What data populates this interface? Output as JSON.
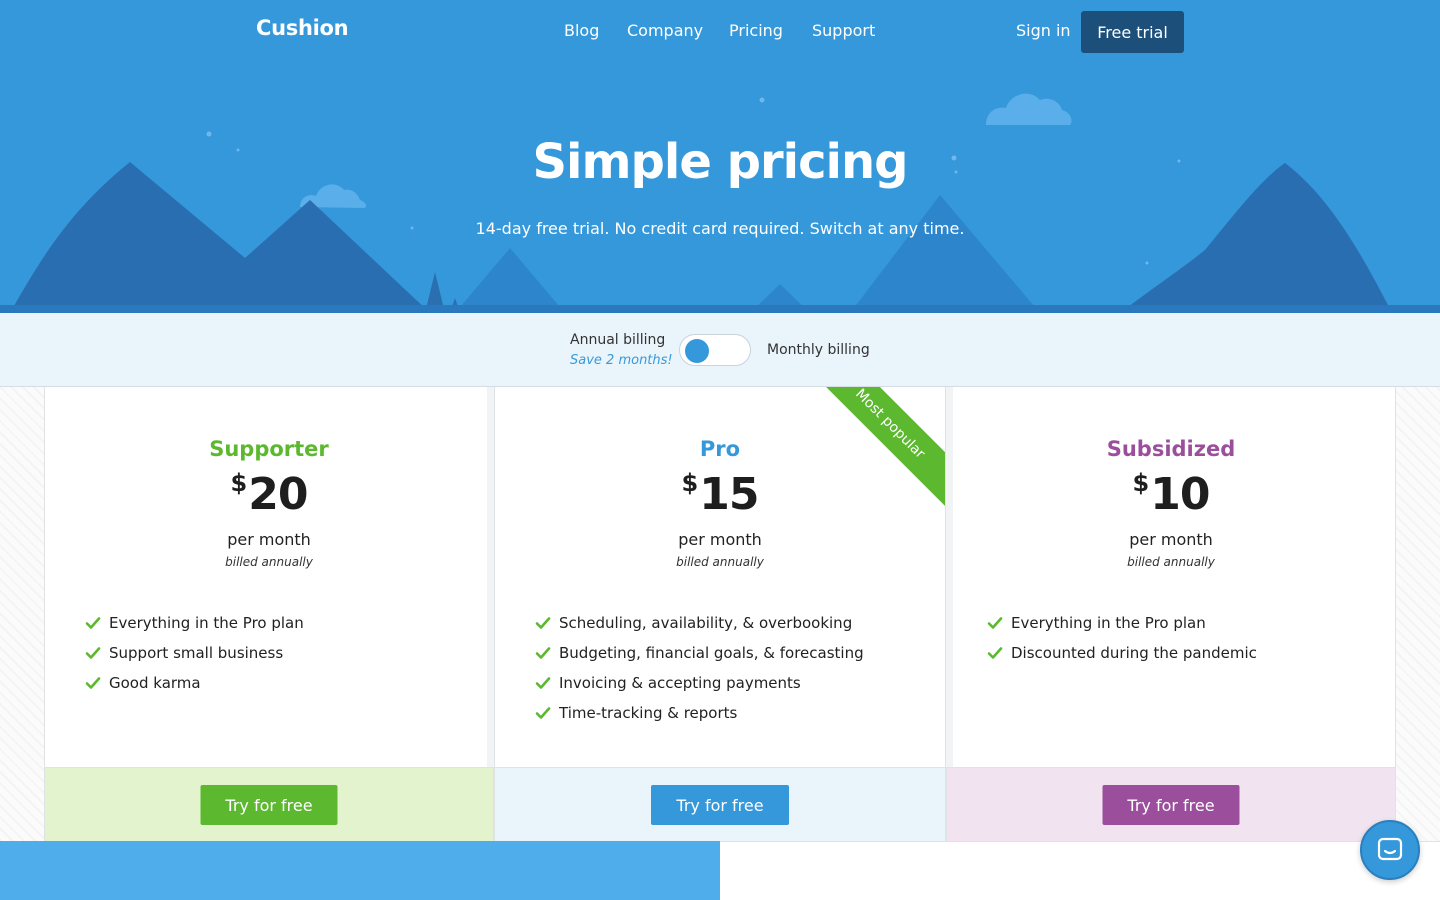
{
  "header": {
    "logo": "Cushion",
    "nav": [
      "Blog",
      "Company",
      "Pricing",
      "Support"
    ],
    "signin": "Sign in",
    "cta": "Free trial"
  },
  "hero": {
    "title": "Simple pricing",
    "subtitle": "14-day free trial. No credit card required. Switch at any time."
  },
  "billing": {
    "annual_label": "Annual billing",
    "save_note": "Save 2 months!",
    "monthly_label": "Monthly billing",
    "selected": "annual"
  },
  "plans": [
    {
      "name": "Supporter",
      "currency": "$",
      "price": "20",
      "period": "per month",
      "billing": "billed annually",
      "features": [
        "Everything in the Pro plan",
        "Support small business",
        "Good karma"
      ],
      "button": "Try for free",
      "color": "#5cb82f"
    },
    {
      "name": "Pro",
      "currency": "$",
      "price": "15",
      "period": "per month",
      "billing": "billed annually",
      "ribbon": "Most popular",
      "features": [
        "Scheduling, availability, & overbooking",
        "Budgeting, financial goals, & forecasting",
        "Invoicing & accepting payments",
        "Time-tracking & reports"
      ],
      "button": "Try for free",
      "color": "#3498db"
    },
    {
      "name": "Subsidized",
      "currency": "$",
      "price": "10",
      "period": "per month",
      "billing": "billed annually",
      "features": [
        "Everything in the Pro plan",
        "Discounted during the pandemic"
      ],
      "button": "Try for free",
      "color": "#9b4e9c"
    }
  ],
  "icons": {
    "check": "check-icon",
    "chat": "chat-icon"
  },
  "colors": {
    "hero_bg": "#3498db",
    "check": "#5cb82f"
  }
}
